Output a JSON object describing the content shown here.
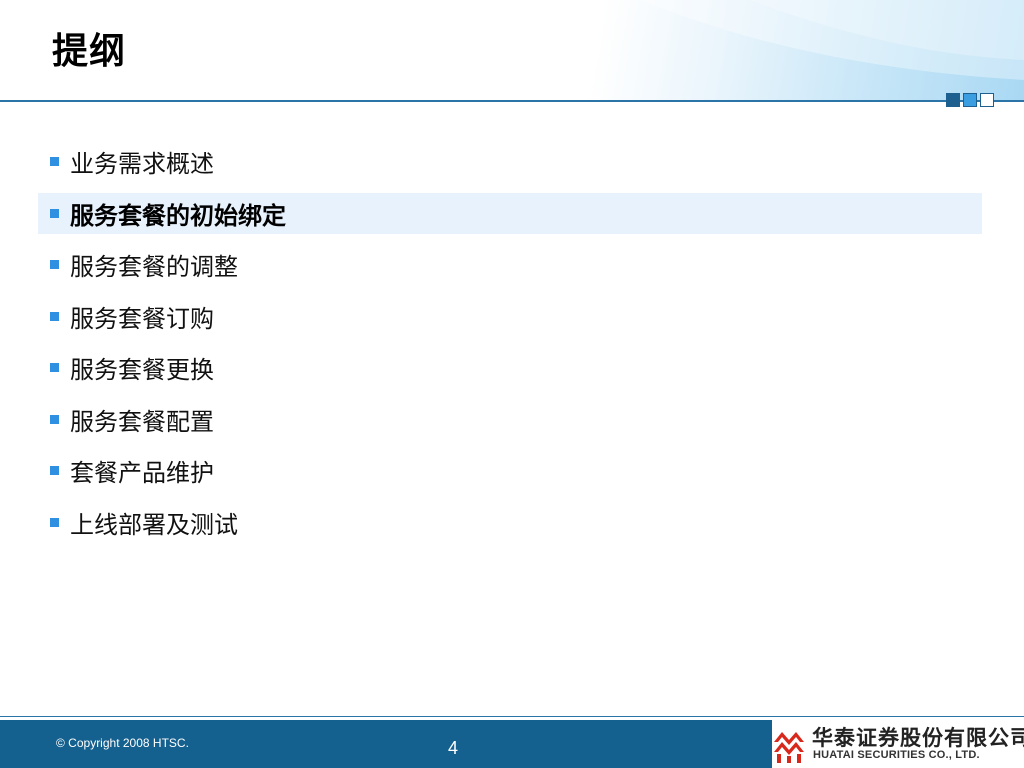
{
  "slide": {
    "title": "提纲",
    "agenda": [
      {
        "label": "业务需求概述",
        "active": false
      },
      {
        "label": "服务套餐的初始绑定",
        "active": true
      },
      {
        "label": "服务套餐的调整",
        "active": false
      },
      {
        "label": "服务套餐订购",
        "active": false
      },
      {
        "label": "服务套餐更换",
        "active": false
      },
      {
        "label": "服务套餐配置",
        "active": false
      },
      {
        "label": "套餐产品维护",
        "active": false
      },
      {
        "label": "上线部署及测试",
        "active": false
      }
    ],
    "footer": {
      "copyright": "© Copyright 2008 HTSC.",
      "page_number": "4"
    },
    "logo": {
      "name_cn": "华泰证券股份有限公司",
      "name_en": "HUATAI SECURITIES CO., LTD.",
      "mark_icon": "huatai-logo-icon"
    }
  },
  "colors": {
    "accent": "#2b74a8",
    "bullet": "#2f8fe0",
    "footer_bar": "#14608f",
    "highlight": "#e8f2fc",
    "logo_red": "#d8281c"
  }
}
